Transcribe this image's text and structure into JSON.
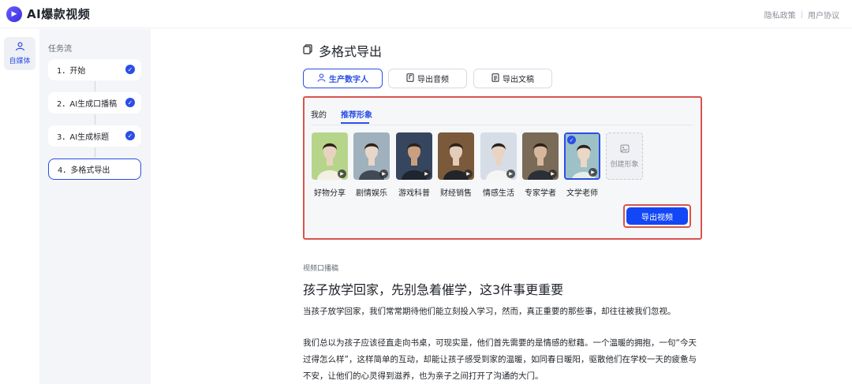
{
  "header": {
    "brand": "AI爆款视频",
    "links": [
      "隐私政策",
      "|",
      "用户协议"
    ]
  },
  "rail": {
    "item_label": "自媒体"
  },
  "workflow": {
    "title": "任务流",
    "steps": [
      {
        "label": "1．开始",
        "done": true
      },
      {
        "label": "2．AI生成口播稿",
        "done": true
      },
      {
        "label": "3．AI生成标题",
        "done": true
      },
      {
        "label": "4．多格式导出",
        "done": false
      }
    ]
  },
  "main": {
    "title": "多格式导出",
    "tabs": [
      {
        "label": "生产数字人",
        "icon": "person-icon"
      },
      {
        "label": "导出音频",
        "icon": "audio-file-icon"
      },
      {
        "label": "导出文稿",
        "icon": "doc-file-icon"
      }
    ],
    "sub_tabs": [
      "我的",
      "推荐形象"
    ],
    "avatars": [
      {
        "label": "好物分享",
        "colors": [
          "#b7d58a",
          "#f2f0e4",
          "#e8d3c0"
        ]
      },
      {
        "label": "剧情娱乐",
        "colors": [
          "#9fb1bc",
          "#404a55",
          "#e8d6c8"
        ]
      },
      {
        "label": "游戏科普",
        "colors": [
          "#36465e",
          "#1e2430",
          "#c99f80"
        ]
      },
      {
        "label": "财经销售",
        "colors": [
          "#7a5a3a",
          "#22242a",
          "#e4cdb8"
        ]
      },
      {
        "label": "情感生活",
        "colors": [
          "#d6dde6",
          "#f5f5f5",
          "#e9d4c4"
        ]
      },
      {
        "label": "专家学者",
        "colors": [
          "#7a6a58",
          "#2c2f36",
          "#d7b89c"
        ]
      },
      {
        "label": "文学老师",
        "colors": [
          "#9ec1c8",
          "#e6efe9",
          "#ecd6c6"
        ]
      }
    ],
    "create_label": "创建形象",
    "export_button": "导出视频",
    "section_label": "视频口播稿",
    "article_title": "孩子放学回家，先别急着催学，这3件事更重要",
    "paragraphs": [
      "当孩子放学回家，我们常常期待他们能立刻投入学习，然而，真正重要的那些事，却往往被我们忽视。",
      "我们总以为孩子应该径直走向书桌，可现实是，他们首先需要的是情感的慰藉。一个温暖的拥抱，一句“今天过得怎么样”，这样简单的互动，却能让孩子感受到家的温暖，如同春日暖阳，驱散他们在学校一天的疲惫与不安，让他们的心灵得到滋养，也为亲子之间打开了沟通的大门。"
    ]
  },
  "colors": {
    "accent": "#2b4ee6",
    "export_button": "#1346f5",
    "highlight_border": "#d9534f"
  }
}
